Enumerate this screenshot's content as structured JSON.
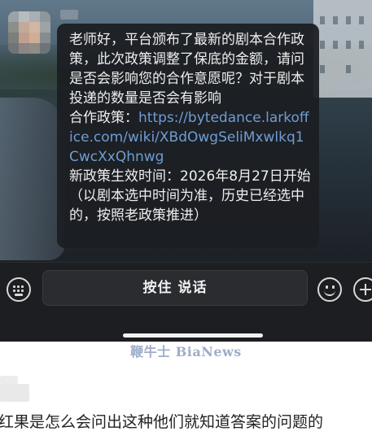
{
  "chat": {
    "message_paragraphs": [
      "老师好，平台颁布了最新的剧本合作政策，此次政策调整了保底的金额，请问是否会影响您的合作意愿呢？对于剧本投递的数量是否会有影响",
      "新政策生效时间：2026年8月27日开始（以剧本选中时间为准，历史已经选中的，按照老政策推进）"
    ],
    "policy_label": "合作政策：",
    "policy_link": "https://bytedance.larkoffice.com/wiki/XBdOwgSeliMxwlkq1CwcXxQhnwg"
  },
  "input_bar": {
    "voice_button_label": "按住 说话"
  },
  "watermark": "鞭牛士 BiaNews",
  "comment": {
    "text": "红果是怎么会问出这种他们就知道答案的问题的"
  },
  "icons": [
    "keyboard-icon",
    "emoji-icon",
    "plus-icon"
  ],
  "colors": {
    "link": "#6f9dd3",
    "bubble": "#1c1e22",
    "input_bar": "#1d1e21"
  }
}
